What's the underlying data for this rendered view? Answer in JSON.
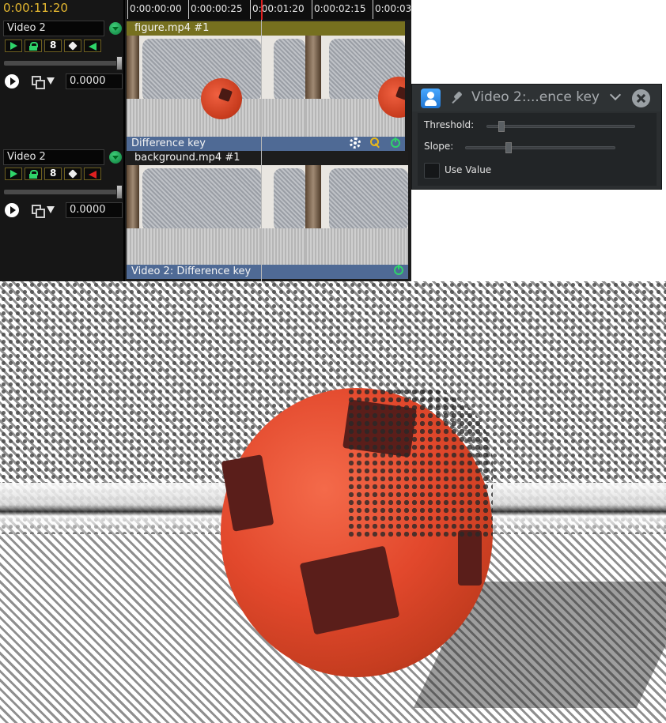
{
  "timeline": {
    "timecode": "0:00:11:20",
    "ruler_ticks": [
      "0:00:00:00",
      "0:00:00:25",
      "0:00:01:20",
      "0:00:02:15",
      "0:00:03"
    ],
    "tracks": [
      {
        "name": "Video 2",
        "value": "0.0000",
        "mute_active": false,
        "media_title": "figure.mp4 #1",
        "effect_title": "Difference key"
      },
      {
        "name": "Video 2",
        "value": "0.0000",
        "mute_active": true,
        "media_title": "background.mp4 #1",
        "effect_title": "Video 2: Difference key"
      }
    ]
  },
  "effect_dialog": {
    "title": "Video 2:...ence key",
    "threshold_label": "Threshold:",
    "slope_label": "Slope:",
    "use_value_label": "Use Value",
    "use_value_checked": false,
    "threshold_level": 0.08,
    "slope_level": 0.28
  },
  "colors": {
    "timecode": "#e5b830",
    "media_bar": "#76701f",
    "effect_bar": "#4f6a95",
    "accent_green": "#2fd46a",
    "mute_red": "#e02020"
  }
}
